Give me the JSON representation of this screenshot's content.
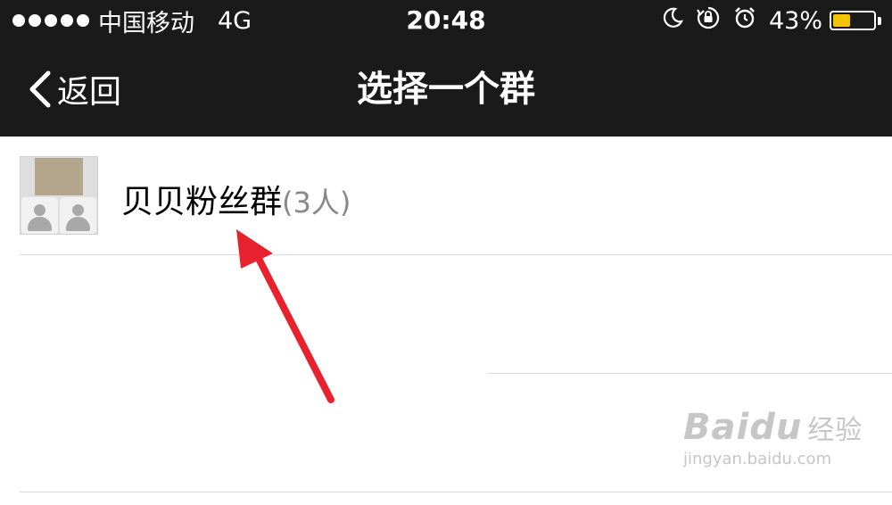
{
  "status_bar": {
    "carrier": "中国移动",
    "network": "4G",
    "time": "20:48",
    "battery_percent": "43%",
    "battery_level": 0.43,
    "signal_icon": "signal-dots-icon",
    "moon_icon": "moon-icon",
    "rotation_lock_icon": "rotation-lock-icon",
    "alarm_icon": "alarm-clock-icon",
    "battery_color": "#f5c400"
  },
  "nav": {
    "back_label": "返回",
    "back_icon": "chevron-left-icon",
    "title": "选择一个群"
  },
  "groups": [
    {
      "name": "贝贝粉丝群",
      "member_count": "(3人)"
    }
  ],
  "watermark": {
    "logo_text": "Baidu",
    "logo_cn": "经验",
    "url": "jingyan.baidu.com"
  },
  "colors": {
    "nav_background": "#1a1a1a",
    "arrow_annotation": "#e8212f"
  }
}
